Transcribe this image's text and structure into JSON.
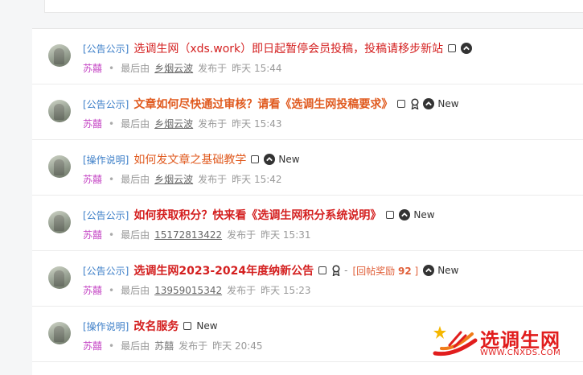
{
  "threads": [
    {
      "category": "[公告公示]",
      "title": "选调生网（xds.work）即日起暂停会员投稿，投稿请移步新站",
      "title_color": "red",
      "bold": false,
      "author": "苏囍",
      "last_by_label": "最后由",
      "last_by": "乡烟云波",
      "published_label": "发布于",
      "time": "昨天 15:44",
      "icons": [
        "checkbox",
        "up"
      ],
      "new_label": ""
    },
    {
      "category": "[公告公示]",
      "title": "文章如何尽快通过审核？请看《选调生网投稿要求》",
      "title_color": "orange",
      "bold": true,
      "author": "苏囍",
      "last_by_label": "最后由",
      "last_by": "乡烟云波",
      "published_label": "发布于",
      "time": "昨天 15:43",
      "icons": [
        "checkbox",
        "award",
        "up"
      ],
      "new_label": "New"
    },
    {
      "category": "[操作说明]",
      "title": "如何发文章之基础教学",
      "title_color": "orange",
      "bold": false,
      "author": "苏囍",
      "last_by_label": "最后由",
      "last_by": "乡烟云波",
      "published_label": "发布于",
      "time": "昨天 15:42",
      "icons": [
        "checkbox",
        "up"
      ],
      "new_label": "New"
    },
    {
      "category": "[公告公示]",
      "title": "如何获取积分？快来看《选调生网积分系统说明》",
      "title_color": "red",
      "bold": true,
      "author": "苏囍",
      "last_by_label": "最后由",
      "last_by": "15172813422",
      "published_label": "发布于",
      "time": "昨天 15:31",
      "icons": [
        "checkbox",
        "up"
      ],
      "new_label": "New"
    },
    {
      "category": "[公告公示]",
      "title": "选调生网2023-2024年度纳新公告",
      "title_color": "red",
      "bold": true,
      "author": "苏囍",
      "last_by_label": "最后由",
      "last_by": "13959015342",
      "published_label": "发布于",
      "time": "昨天 15:23",
      "icons": [
        "checkbox",
        "award",
        "reward",
        "up"
      ],
      "reward_label": "[回帖奖励",
      "reward_value": "92",
      "reward_close": "]",
      "new_label": "New"
    },
    {
      "category": "[操作说明]",
      "title": "改名服务",
      "title_color": "red",
      "bold": true,
      "author": "苏囍",
      "last_by_label": "最后由",
      "last_by": "苏囍",
      "published_label": "发布于",
      "time": "昨天 20:45",
      "icons": [
        "checkbox"
      ],
      "new_label": "New"
    }
  ],
  "watermark": {
    "brand": "选调生网",
    "url": "WWW.CNXDS.COM"
  },
  "colors": {
    "category": "#3d7fc8",
    "title_red": "#d42020",
    "title_orange": "#e05a1f",
    "author": "#c548c5"
  }
}
